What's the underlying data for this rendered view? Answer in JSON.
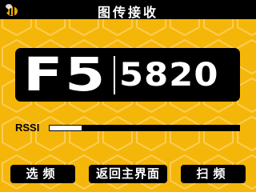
{
  "header": {
    "title": "图传接收",
    "logo_icon": "bee-icon"
  },
  "display": {
    "channel": "F5",
    "frequency": "5820"
  },
  "signal": {
    "label": "RSSI",
    "level_fraction": 0.17
  },
  "buttons": {
    "select_label": "选频",
    "home_label": "返回主界面",
    "scan_label": "扫频"
  },
  "colors": {
    "background": "#f5b60a",
    "hex_pattern": "#fbd060",
    "panel": "#000000",
    "text": "#ffffff",
    "bee_body": "#e8a800"
  }
}
